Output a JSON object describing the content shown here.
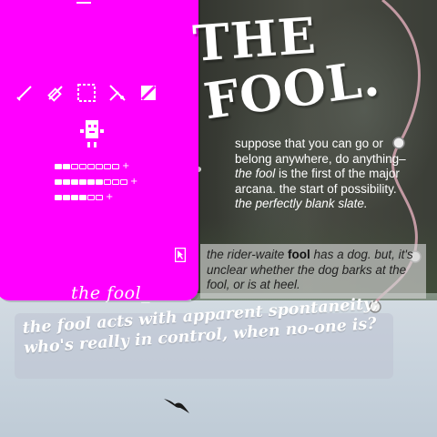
{
  "title": {
    "line1": "THE",
    "line2": "FOOL."
  },
  "paragraph1": {
    "part1": "suppose that you can go or belong anywhere, do anything–",
    "italic1": "the fool",
    "part2": " is the first of the major arcana. the start of possibility. ",
    "italic2": "the perfectly blank slate."
  },
  "paragraph2": {
    "part1": "the rider-waite ",
    "bold": "fool",
    "part2": " has a dog. but, it's unclear whether the dog barks at the fool, or is at heel."
  },
  "paragraph3": {
    "text": "the fool acts with apparent spontaneity; who's really in control, when no-one is?"
  },
  "panel": {
    "signature": "the fool_",
    "color": "#ff00ff",
    "tools": [
      "pencil-icon",
      "eraser-icon",
      "selection-icon",
      "scissors-icon",
      "fill-icon"
    ],
    "meters": [
      {
        "filled": 2,
        "total": 8,
        "plus": "+"
      },
      {
        "filled": 6,
        "total": 9,
        "plus": "+"
      },
      {
        "filled": 4,
        "total": 6,
        "plus": "+"
      }
    ]
  }
}
